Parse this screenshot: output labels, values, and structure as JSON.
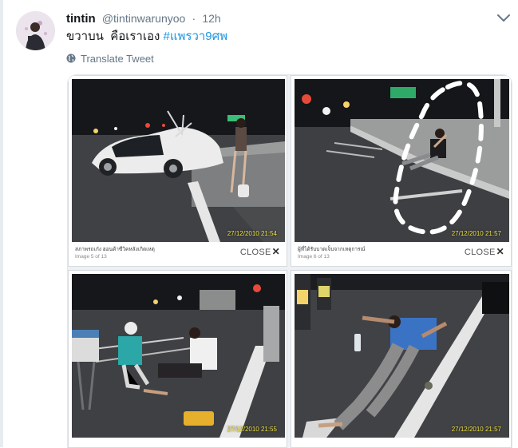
{
  "tweet": {
    "display_name": "tintin",
    "handle": "@tintinwarunyoo",
    "separator": "·",
    "timestamp": "12h",
    "text_prefix": "ขวาบน  คือเราเอง ",
    "hashtag": "#แพรวา9ศพ",
    "translate_label": "Translate Tweet"
  },
  "media": {
    "panels": [
      {
        "stamp": "27/12/2010 21:54",
        "caption": "สภาพรถเก๋ง ฮอนด้าซีวิคหลังเกิดเหตุ",
        "counter": "Image 5 of 13",
        "close": "CLOSE"
      },
      {
        "stamp": "27/12/2010 21:57",
        "caption": "ผู้ที่ได้รับบาดเจ็บจากเหตุการณ์",
        "counter": "Image 6 of 13",
        "close": "CLOSE"
      },
      {
        "stamp": "27/12/2010 21:55",
        "caption": "",
        "counter": "",
        "close": ""
      },
      {
        "stamp": "27/12/2010 21:57",
        "caption": "",
        "counter": "",
        "close": ""
      }
    ]
  },
  "icons": {
    "avatar": "profile-avatar",
    "menu": "chevron-down-icon",
    "translate": "globe-icon",
    "close": "close-x-icon"
  },
  "colors": {
    "link": "#1b95e0",
    "secondary_text": "#657786",
    "timestamp_overlay": "#f2e64a"
  }
}
